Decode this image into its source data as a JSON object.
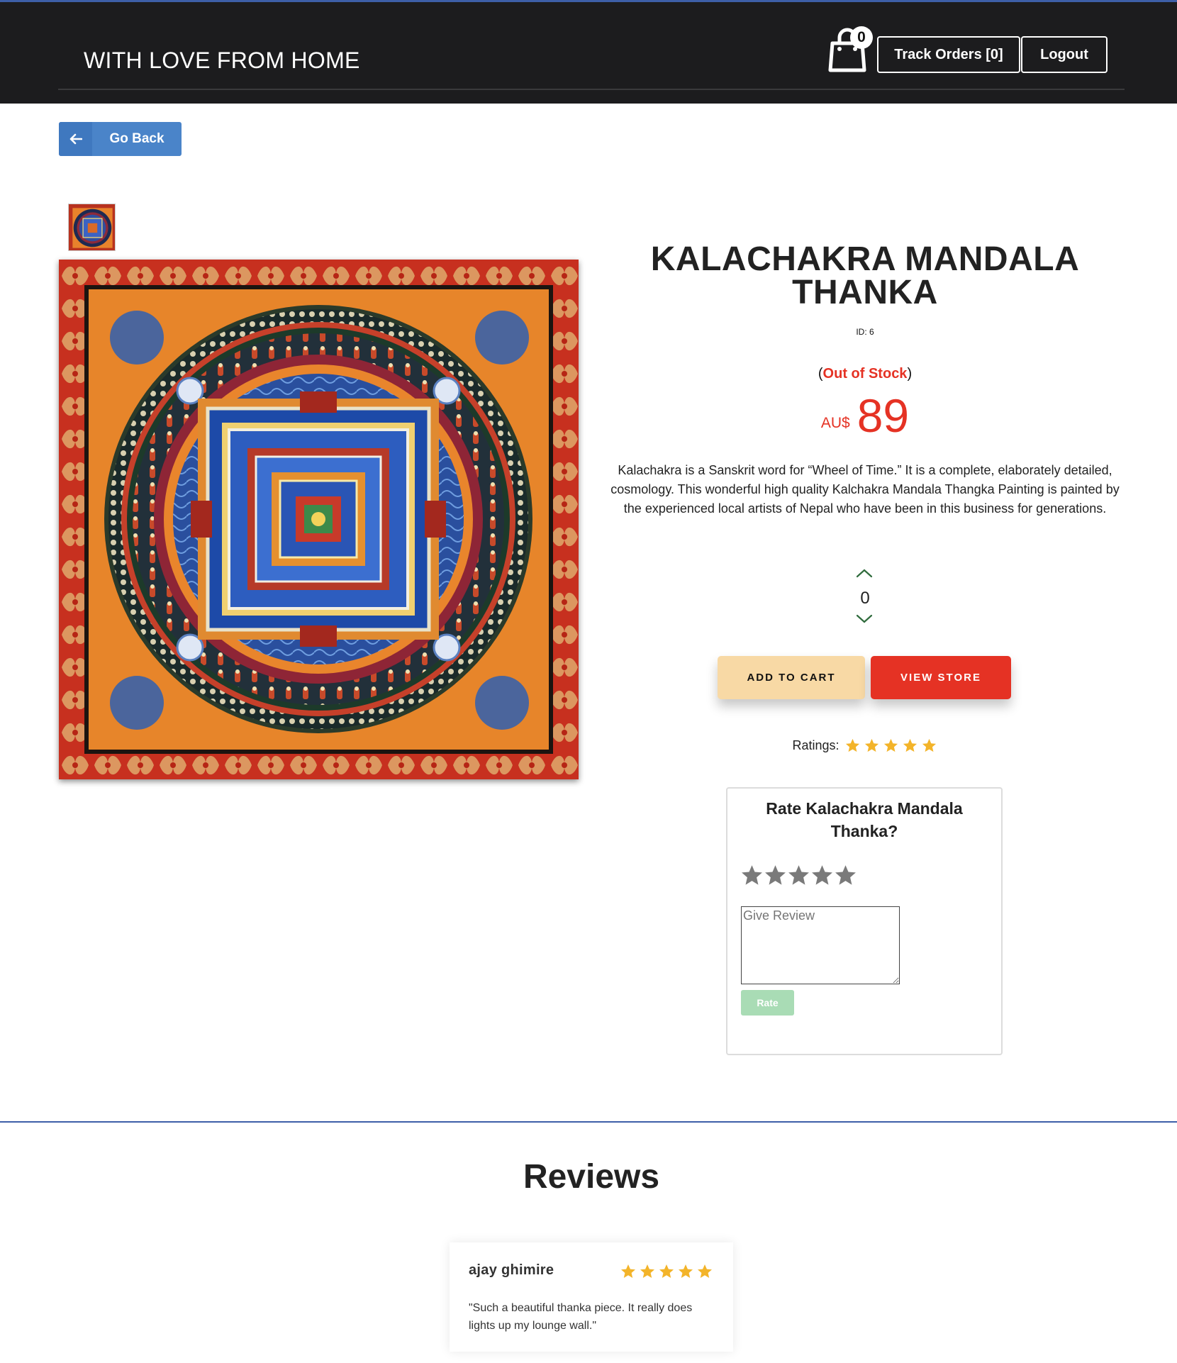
{
  "header": {
    "brand": "WITH LOVE FROM HOME",
    "cart_count": "0",
    "track_orders_label": "Track Orders [0]",
    "logout_label": "Logout"
  },
  "nav": {
    "go_back_label": "Go Back"
  },
  "product": {
    "title": "KALACHAKRA MANDALA THANKA",
    "id_text": "ID: 6",
    "stock_open": "(",
    "stock_status": "Out of Stock",
    "stock_close": ")",
    "currency": "AU$",
    "price": "89",
    "description": "Kalachakra is a Sanskrit word for “Wheel of Time.” It is a complete, elaborately detailed, cosmology. This wonderful high quality Kalchakra Mandala Thangka Painting is painted by the experienced local artists of Nepal who have been in this business for generations.",
    "quantity": "0",
    "add_to_cart_label": "ADD TO CART",
    "view_store_label": "VIEW STORE",
    "ratings_label": "Ratings:",
    "rating": 5
  },
  "rate_form": {
    "title": "Rate Kalachakra Mandala Thanka?",
    "selected_stars": 0,
    "review_placeholder": "Give Review",
    "rate_button_label": "Rate"
  },
  "reviews": {
    "title": "Reviews",
    "items": [
      {
        "author": "ajay ghimire",
        "stars": 5,
        "text": "\"Such a beautiful thanka piece. It really does lights up my lounge wall.\""
      }
    ]
  },
  "colors": {
    "header_bg": "#1c1c1e",
    "accent_blue": "#4a84c9",
    "price_red": "#e53224",
    "add_to_cart_bg": "#f8d9a5",
    "star_gold": "#f3b42a",
    "rate_button_bg": "#a9dcb5"
  }
}
